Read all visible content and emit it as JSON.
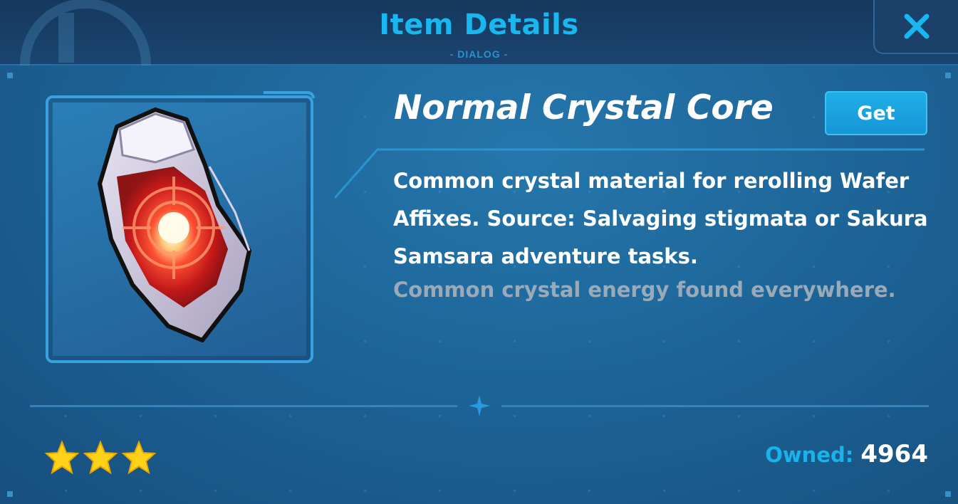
{
  "header": {
    "title": "Item Details",
    "subtitle": "- DIALOG -",
    "close_icon": "close-icon"
  },
  "item": {
    "name": "Normal Crystal Core",
    "image_icon": "red-crystal-core-icon",
    "description": "Common crystal material for rerolling Wafer Affixes. Source: Salvaging stigmata or Sakura Samsara adventure tasks.",
    "flavor_text": "Common crystal energy found everywhere.",
    "rarity_stars": 3,
    "owned_label": "Owned:",
    "owned_count": "4964"
  },
  "actions": {
    "get_label": "Get"
  },
  "colors": {
    "accent": "#19b7ef",
    "star": "#ffd21a",
    "background": "#1d6598"
  }
}
